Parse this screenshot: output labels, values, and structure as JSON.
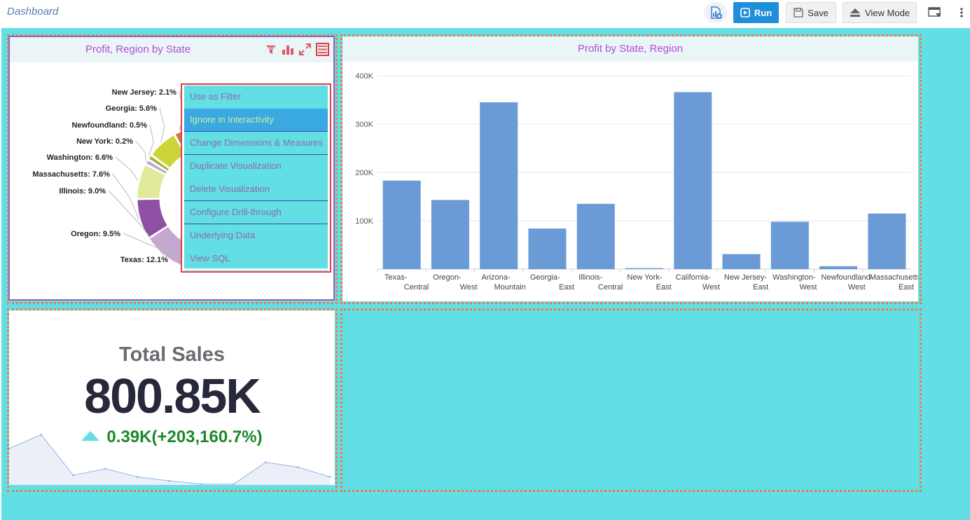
{
  "toolbar": {
    "title": "Dashboard",
    "run_label": "Run",
    "save_label": "Save",
    "view_mode_label": "View Mode"
  },
  "panel_pie": {
    "title": "Profit, Region by State",
    "menu": [
      {
        "label": "Use as Filter",
        "active": false,
        "sep": false
      },
      {
        "label": "Ignore in Interactivity",
        "active": true,
        "sep": true
      },
      {
        "label": "Change Dimensions & Measures",
        "active": false,
        "sep": true
      },
      {
        "label": "Duplicate Visualization",
        "active": false,
        "sep": false
      },
      {
        "label": "Delete Visualization",
        "active": false,
        "sep": true
      },
      {
        "label": "Configure Drill-through",
        "active": false,
        "sep": true
      },
      {
        "label": "Underlying Data",
        "active": false,
        "sep": false
      },
      {
        "label": "View SQL",
        "active": false,
        "sep": false
      }
    ]
  },
  "panel_bar": {
    "title": "Profit by State, Region"
  },
  "kpi": {
    "title": "Total Sales",
    "value": "800.85K",
    "delta": "0.39K(+203,160.7%)",
    "accent": "#62dfe5"
  },
  "chart_data": [
    {
      "type": "pie",
      "title": "Profit, Region by State",
      "slices": [
        {
          "label": "New Jersey: 2.1%",
          "value": 2.1,
          "color": "#c87c3a"
        },
        {
          "label": "Georgia: 5.6%",
          "value": 5.6,
          "color": "#cdd43a"
        },
        {
          "label": "Newfoundland: 0.5%",
          "value": 0.5,
          "color": "#a9b52e"
        },
        {
          "label": "New York: 0.2%",
          "value": 0.2,
          "color": "#b6a8d8"
        },
        {
          "label": "Washington: 6.6%",
          "value": 6.6,
          "color": "#e2e89a"
        },
        {
          "label": "Massachusetts: 7.6%",
          "value": 7.6,
          "color": "#8e4fa5"
        },
        {
          "label": "Illinois: 9.0%",
          "value": 9.0,
          "color": "#c4a8d0"
        },
        {
          "label": "Oregon: 9.5%",
          "value": 9.5,
          "color": "#f89a3a"
        },
        {
          "label": "Texas: 12.1%",
          "value": 12.1,
          "color": "#f6b95a"
        }
      ]
    },
    {
      "type": "bar",
      "title": "Profit by State, Region",
      "categories": [
        "Texas-Central",
        "Oregon-West",
        "Arizona-Mountain",
        "Georgia-East",
        "Illinois-Central",
        "New York-East",
        "California-West",
        "New Jersey-East",
        "Washington-West",
        "Newfoundland-West",
        "Massachusetts-East"
      ],
      "category_lines": [
        [
          "Texas-",
          "Central"
        ],
        [
          "Oregon-",
          "West"
        ],
        [
          "Arizona-",
          "Mountain"
        ],
        [
          "Georgia-",
          "East"
        ],
        [
          "Illinois-",
          "Central"
        ],
        [
          "New York-",
          "East"
        ],
        [
          "California-",
          "West"
        ],
        [
          "New Jersey-",
          "East"
        ],
        [
          "Washington-",
          "West"
        ],
        [
          "Newfoundland-",
          "West"
        ],
        [
          "Massachusetts-",
          "East"
        ]
      ],
      "values": [
        183000,
        143000,
        345000,
        84000,
        135000,
        2000,
        366000,
        31000,
        98000,
        6000,
        115000
      ],
      "yticks": [
        "400K",
        "300K",
        "200K",
        "100K"
      ],
      "ytick_values": [
        400000,
        300000,
        200000,
        100000
      ],
      "ylim": [
        0,
        400000
      ],
      "color": "#6a9bd6",
      "grid": true
    },
    {
      "type": "area",
      "title": "",
      "values": [
        45,
        62,
        12,
        20,
        10,
        5,
        1,
        1,
        28,
        22,
        10
      ],
      "ylim": [
        0,
        70
      ],
      "color": "#8fb7e8"
    }
  ]
}
